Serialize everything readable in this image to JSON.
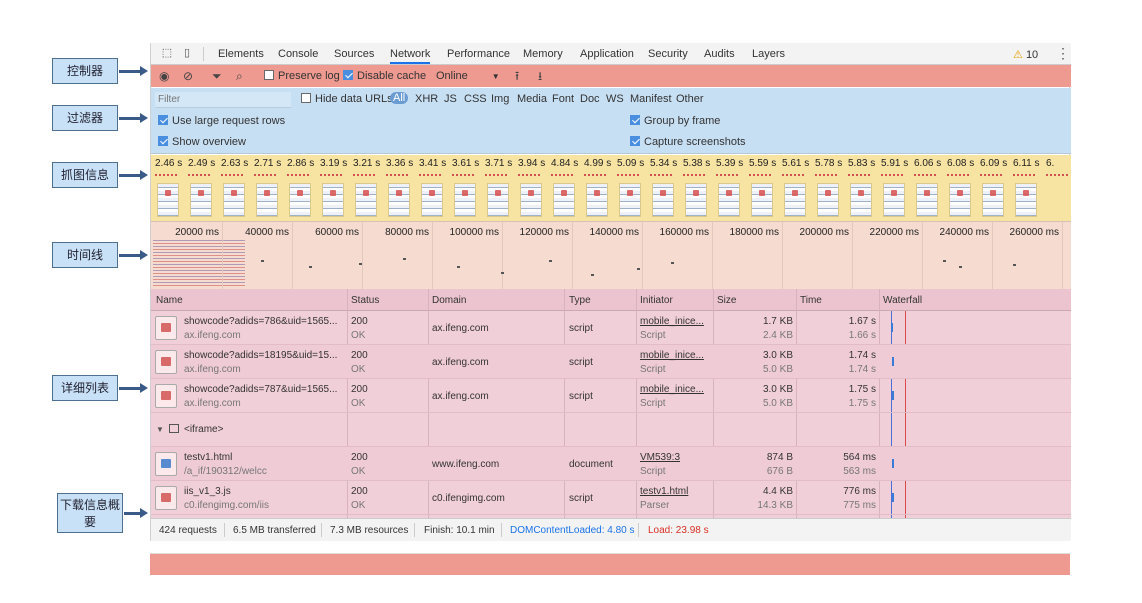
{
  "tabs": [
    "Elements",
    "Console",
    "Sources",
    "Network",
    "Performance",
    "Memory",
    "Application",
    "Security",
    "Audits",
    "Layers"
  ],
  "active_tab": "Network",
  "warning_count": "10",
  "icons": {
    "inspect": "cursor-select-icon",
    "device": "device-toolbar-icon",
    "record": "record-icon",
    "clear": "clear-icon",
    "filter": "filter-icon",
    "search": "search-icon",
    "upload": "import-har-icon",
    "download": "export-har-icon",
    "warning": "warning-icon",
    "menu": "kebab-menu-icon"
  },
  "controls": {
    "preserve_log": "Preserve log",
    "disable_cache": "Disable cache",
    "throttling": "Online"
  },
  "filter": {
    "placeholder": "Filter",
    "hide_data_urls": "Hide data URLs",
    "types": [
      "All",
      "XHR",
      "JS",
      "CSS",
      "Img",
      "Media",
      "Font",
      "Doc",
      "WS",
      "Manifest",
      "Other"
    ],
    "use_large_rows": "Use large request rows",
    "show_overview": "Show overview",
    "group_by_frame": "Group by frame",
    "capture_screenshots": "Capture screenshots"
  },
  "screenshots": [
    "2.46 s",
    "2.49 s",
    "2.63 s",
    "2.71 s",
    "2.86 s",
    "3.19 s",
    "3.21 s",
    "3.36 s",
    "3.41 s",
    "3.61 s",
    "3.71 s",
    "3.94 s",
    "4.84 s",
    "4.99 s",
    "5.09 s",
    "5.34 s",
    "5.38 s",
    "5.39 s",
    "5.59 s",
    "5.61 s",
    "5.78 s",
    "5.83 s",
    "5.91 s",
    "6.06 s",
    "6.08 s",
    "6.09 s",
    "6.11 s",
    "6."
  ],
  "overview_ticks": [
    "20000 ms",
    "40000 ms",
    "60000 ms",
    "80000 ms",
    "100000 ms",
    "120000 ms",
    "140000 ms",
    "160000 ms",
    "180000 ms",
    "200000 ms",
    "220000 ms",
    "240000 ms",
    "260000 ms"
  ],
  "columns": [
    "Name",
    "Status",
    "Domain",
    "Type",
    "Initiator",
    "Size",
    "Time",
    "Waterfall"
  ],
  "rows": [
    {
      "name": "showcode?adids=786&uid=1565...",
      "path": "ax.ifeng.com",
      "status": "200",
      "status_text": "OK",
      "domain": "ax.ifeng.com",
      "type": "script",
      "initiator": "mobile_inice...",
      "initiator_type": "Script",
      "size": "1.7 KB",
      "resource_size": "2.4 KB",
      "time": "1.67 s",
      "latency": "1.66 s"
    },
    {
      "name": "showcode?adids=18195&uid=15...",
      "path": "ax.ifeng.com",
      "status": "200",
      "status_text": "OK",
      "domain": "ax.ifeng.com",
      "type": "script",
      "initiator": "mobile_inice...",
      "initiator_type": "Script",
      "size": "3.0 KB",
      "resource_size": "5.0 KB",
      "time": "1.74 s",
      "latency": "1.74 s"
    },
    {
      "name": "showcode?adids=787&uid=1565...",
      "path": "ax.ifeng.com",
      "status": "200",
      "status_text": "OK",
      "domain": "ax.ifeng.com",
      "type": "script",
      "initiator": "mobile_inice...",
      "initiator_type": "Script",
      "size": "3.0 KB",
      "resource_size": "5.0 KB",
      "time": "1.75 s",
      "latency": "1.75 s"
    },
    {
      "name": "testv1.html",
      "path": "/a_if/190312/welcc",
      "status": "200",
      "status_text": "OK",
      "domain": "www.ifeng.com",
      "type": "document",
      "initiator": "VM539:3",
      "initiator_type": "Script",
      "size": "874 B",
      "resource_size": "676 B",
      "time": "564 ms",
      "latency": "563 ms"
    },
    {
      "name": "iis_v1_3.js",
      "path": "c0.ifengimg.com/iis",
      "status": "200",
      "status_text": "OK",
      "domain": "c0.ifengimg.com",
      "type": "script",
      "initiator": "testv1.html",
      "initiator_type": "Parser",
      "size": "4.4 KB",
      "resource_size": "14.3 KB",
      "time": "776 ms",
      "latency": "775 ms"
    }
  ],
  "group_label": "<iframe>",
  "summary": {
    "requests": "424 requests",
    "transferred": "6.5 MB transferred",
    "resources": "7.3 MB resources",
    "finish": "Finish: 10.1 min",
    "dcl": "DOMContentLoaded: 4.80 s",
    "load": "Load: 23.98 s",
    "dcl_color": "#1a73e8",
    "load_color": "#d93025"
  },
  "annotations": {
    "controls": "控制器",
    "filter": "过滤器",
    "screenshots": "抓图信息",
    "timeline": "时间线",
    "list": "详细列表",
    "summary": "下载信息概要"
  }
}
